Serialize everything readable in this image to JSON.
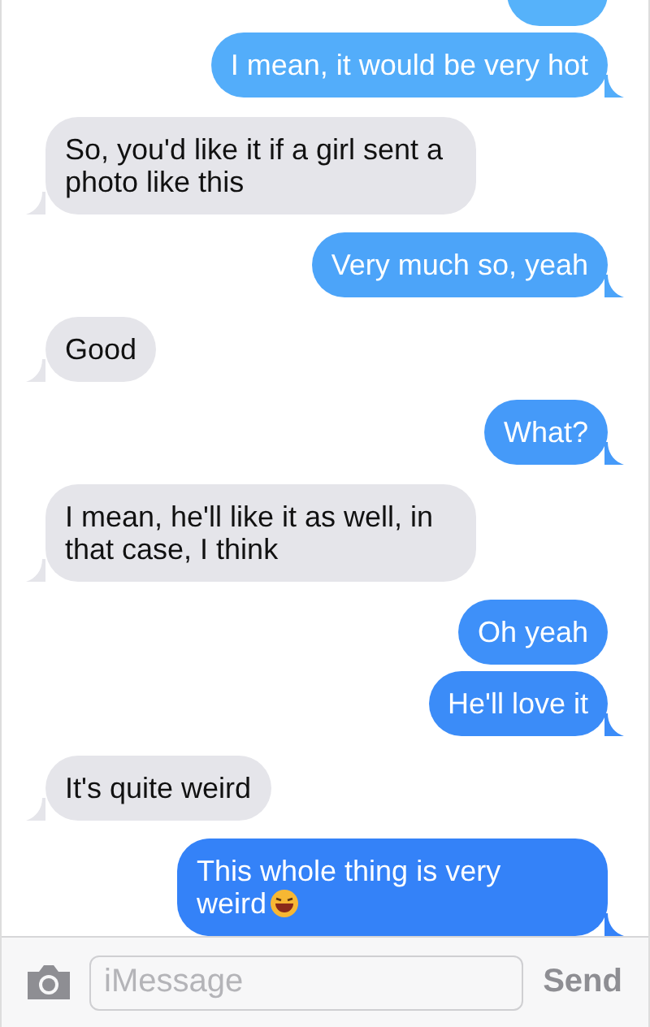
{
  "messages": [
    {
      "kind": "sent",
      "tail": false
    },
    {
      "kind": "sent",
      "text": "I mean, it would be very hot",
      "tail": true
    },
    {
      "kind": "received",
      "text": "So, you'd like it if a girl sent a photo like this",
      "tail": true
    },
    {
      "kind": "sent",
      "text": "Very much so, yeah",
      "tail": true
    },
    {
      "kind": "received",
      "text": "Good",
      "tail": true
    },
    {
      "kind": "sent",
      "text": "What?",
      "tail": true
    },
    {
      "kind": "received",
      "text": "I mean, he'll like it as well, in that case, I think",
      "tail": true
    },
    {
      "kind": "sent",
      "text": "Oh yeah",
      "tail": false
    },
    {
      "kind": "sent",
      "text": "He'll love it",
      "tail": true
    },
    {
      "kind": "received",
      "text": "It's quite weird",
      "tail": true
    },
    {
      "kind": "sent",
      "text": "This whole thing is very weird",
      "has_emoji": true,
      "tail": true
    }
  ],
  "composer": {
    "placeholder": "iMessage",
    "send": "Send"
  }
}
